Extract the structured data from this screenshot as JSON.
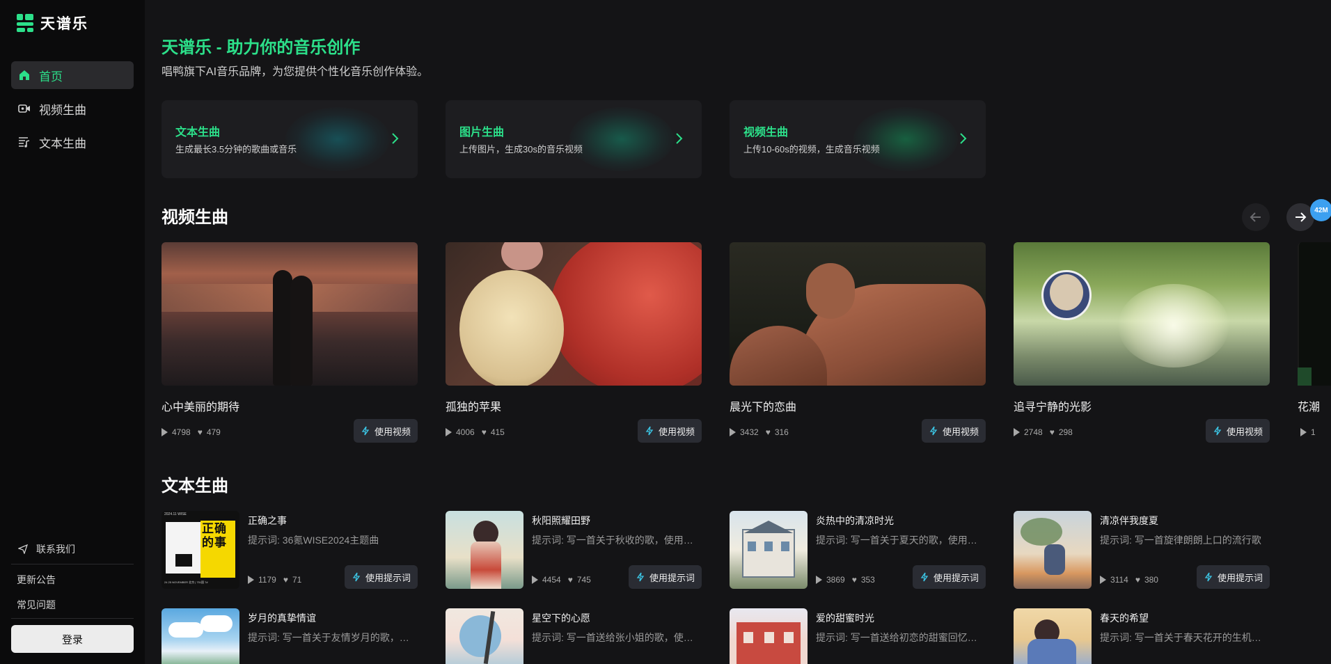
{
  "app": {
    "name": "天谱乐"
  },
  "sidebar": {
    "nav": [
      {
        "label": "首页",
        "active": true,
        "icon": "home-icon"
      },
      {
        "label": "视频生曲",
        "active": false,
        "icon": "video-icon"
      },
      {
        "label": "文本生曲",
        "active": false,
        "icon": "text-music-icon"
      }
    ],
    "contact_label": "联系我们",
    "links": [
      "更新公告",
      "常见问题"
    ],
    "login_label": "登录"
  },
  "hero": {
    "title": "天谱乐 - 助力你的音乐创作",
    "subtitle": "唱鸭旗下AI音乐品牌，为您提供个性化音乐创作体验。"
  },
  "features": [
    {
      "title": "文本生曲",
      "desc": "生成最长3.5分钟的歌曲或音乐"
    },
    {
      "title": "图片生曲",
      "desc": "上传图片，生成30s的音乐视频"
    },
    {
      "title": "视频生曲",
      "desc": "上传10-60s的视频，生成音乐视频"
    }
  ],
  "video_section": {
    "title": "视频生曲",
    "badge": "42M",
    "use_label": "使用视频",
    "items": [
      {
        "title": "心中美丽的期待",
        "plays": "4798",
        "likes": "479"
      },
      {
        "title": "孤独的苹果",
        "plays": "4006",
        "likes": "415"
      },
      {
        "title": "晨光下的恋曲",
        "plays": "3432",
        "likes": "316"
      },
      {
        "title": "追寻宁静的光影",
        "plays": "2748",
        "likes": "298"
      },
      {
        "title": "花潮",
        "plays": "1",
        "likes": ""
      }
    ]
  },
  "text_section": {
    "title": "文本生曲",
    "use_label": "使用提示词",
    "thumb_text": {
      "big": "正确的事",
      "tags": "2024.11 WISE",
      "date": "24 25 NOVEMBER 北京 | 751国 7#"
    },
    "items": [
      {
        "title": "正确之事",
        "prompt": "提示词: 36氪WISE2024主题曲",
        "plays": "1179",
        "likes": "71"
      },
      {
        "title": "秋阳照耀田野",
        "prompt": "提示词: 写一首关于秋收的歌，使用摇…",
        "plays": "4454",
        "likes": "745"
      },
      {
        "title": "炎热中的清凉时光",
        "prompt": "提示词: 写一首关于夏天的歌，使用古…",
        "plays": "3869",
        "likes": "353"
      },
      {
        "title": "清凉伴我度夏",
        "prompt": "提示词: 写一首旋律朗朗上口的流行歌",
        "plays": "3114",
        "likes": "380"
      },
      {
        "title": "岁月的真挚情谊",
        "prompt": "提示词: 写一首关于友情岁月的歌，使…",
        "plays": "",
        "likes": ""
      },
      {
        "title": "星空下的心愿",
        "prompt": "提示词: 写一首送给张小姐的歌，使用…",
        "plays": "",
        "likes": ""
      },
      {
        "title": "爱的甜蜜时光",
        "prompt": "提示词: 写一首送给初恋的甜蜜回忆之…",
        "plays": "",
        "likes": ""
      },
      {
        "title": "春天的希望",
        "prompt": "提示词: 写一首关于春天花开的生机之…",
        "plays": "",
        "likes": ""
      }
    ]
  },
  "colors": {
    "accent": "#2ce08a",
    "background": "#141416",
    "sidebar": "#0b0b0c",
    "card": "#1d1d20"
  }
}
